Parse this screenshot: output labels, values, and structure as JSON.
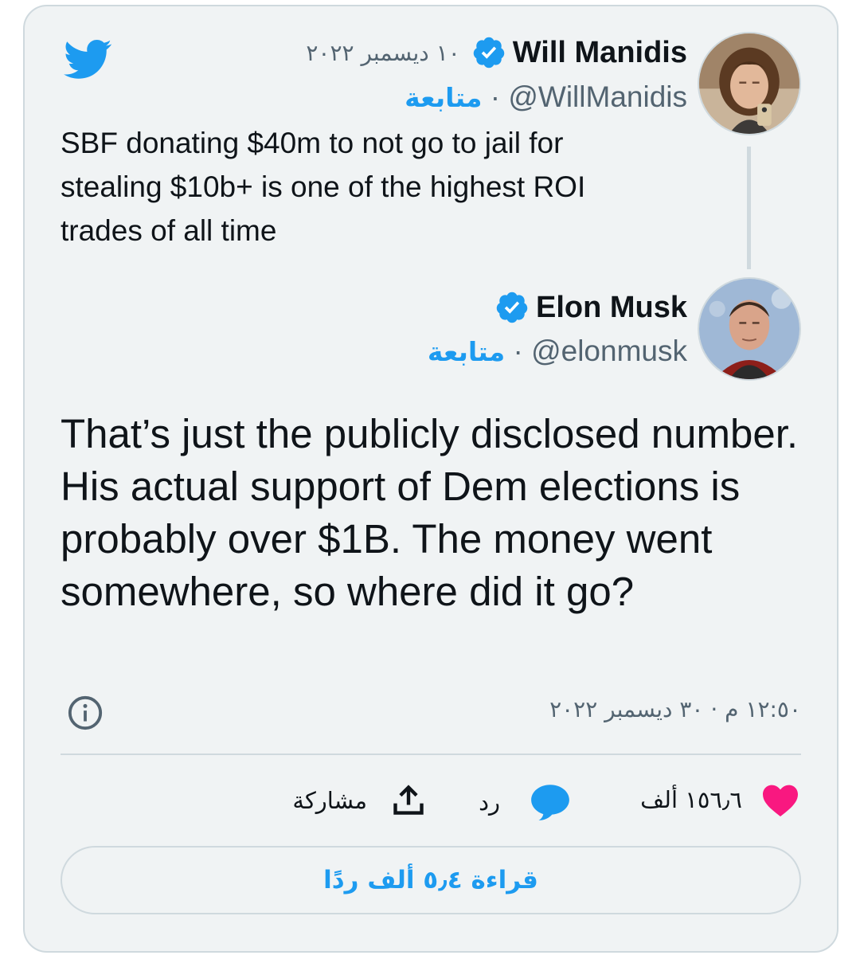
{
  "icons": {
    "brand": "twitter-bird-icon",
    "verified": "verified-badge-icon",
    "info": "info-icon",
    "like": "heart-icon",
    "reply": "speech-bubble-icon",
    "share": "share-upload-icon"
  },
  "colors": {
    "accent": "#1d9bf0",
    "like": "#f91880",
    "text": "#0f1419",
    "muted": "#536471",
    "card_bg": "#f0f3f4",
    "border": "#cfd9de"
  },
  "quoted_tweet": {
    "author_name": "Will Manidis",
    "handle": "@WillManidis",
    "follow_label": "متابعة",
    "date": "١٠ ديسمبر ٢٠٢٢",
    "text": "SBF donating $40m to not go to jail for stealing $10b+ is one of the highest ROI trades of all time"
  },
  "main_tweet": {
    "author_name": "Elon Musk",
    "handle": "@elonmusk",
    "follow_label": "متابعة",
    "text": "That’s just the publicly disclosed number. His actual support of Dem elections is probably over $1B. The money went somewhere, so where did it go?",
    "timestamp": "١٢:٥٠ م · ٣٠ ديسمبر ٢٠٢٢"
  },
  "actions": {
    "like_count": "١٥٦٫٦ ألف",
    "reply_label": "رد",
    "share_label": "مشاركة"
  },
  "read_replies_label": "قراءة ٥٫٤ ألف ردًا"
}
